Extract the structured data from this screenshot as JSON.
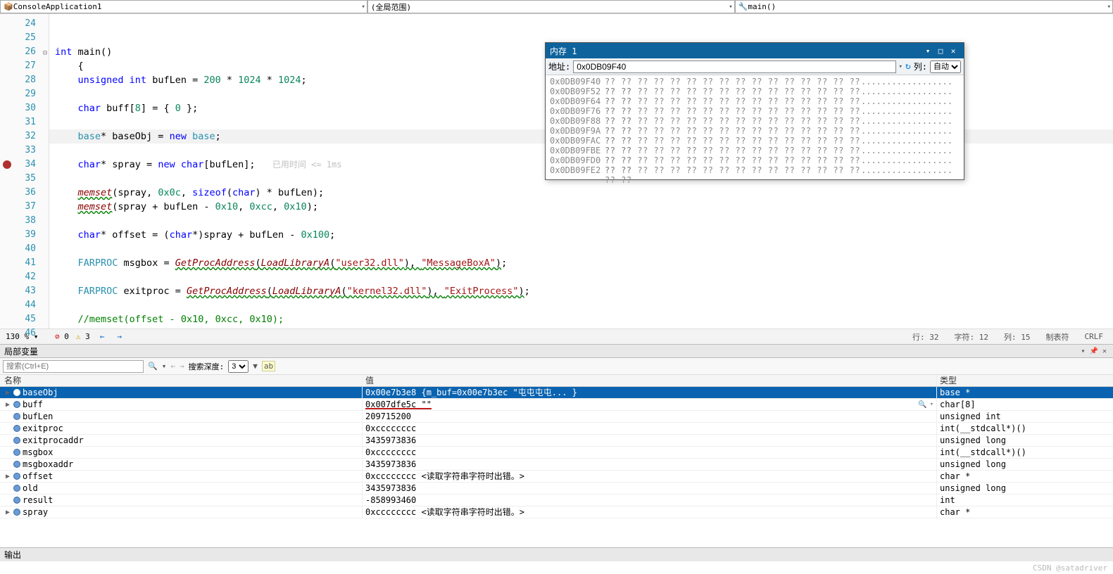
{
  "top": {
    "left": "ConsoleApplication1",
    "mid": "(全局范围)",
    "right": "main()"
  },
  "code": {
    "lines": [
      {
        "n": 24
      },
      {
        "n": 25
      },
      {
        "n": 26,
        "collapse": true,
        "seg": [
          {
            "t": "int ",
            "c": "kw"
          },
          {
            "t": "main"
          },
          {
            "t": "()"
          }
        ]
      },
      {
        "n": 27,
        "seg": [
          {
            "t": "{"
          }
        ]
      },
      {
        "n": 28,
        "ind": 1,
        "seg": [
          {
            "t": "unsigned int ",
            "c": "kw"
          },
          {
            "t": "bufLen = "
          },
          {
            "t": "200",
            "c": "num"
          },
          {
            "t": " * "
          },
          {
            "t": "1024",
            "c": "num"
          },
          {
            "t": " * "
          },
          {
            "t": "1024",
            "c": "num"
          },
          {
            "t": ";"
          }
        ]
      },
      {
        "n": 29
      },
      {
        "n": 30,
        "ind": 1,
        "seg": [
          {
            "t": "char ",
            "c": "kw"
          },
          {
            "t": "buff["
          },
          {
            "t": "8",
            "c": "num"
          },
          {
            "t": "] = { "
          },
          {
            "t": "0",
            "c": "num"
          },
          {
            "t": " };"
          }
        ]
      },
      {
        "n": 31
      },
      {
        "n": 32,
        "ind": 1,
        "cur": true,
        "seg": [
          {
            "t": "base",
            "c": "typ"
          },
          {
            "t": "* baseObj = "
          },
          {
            "t": "new ",
            "c": "kw"
          },
          {
            "t": "base",
            "c": "typ"
          },
          {
            "t": ";"
          }
        ]
      },
      {
        "n": 33
      },
      {
        "n": 34,
        "ind": 1,
        "bp": true,
        "seg": [
          {
            "t": "char",
            "c": "kw"
          },
          {
            "t": "* spray = "
          },
          {
            "t": "new ",
            "c": "kw"
          },
          {
            "t": "char",
            "c": "kw"
          },
          {
            "t": "[bufLen];   "
          },
          {
            "t": "已用时间 <= 1ms",
            "c": "dim"
          }
        ]
      },
      {
        "n": 35
      },
      {
        "n": 36,
        "ind": 1,
        "seg": [
          {
            "t": "memset",
            "c": "fn",
            "w": true
          },
          {
            "t": "(spray, "
          },
          {
            "t": "0x0c",
            "c": "num"
          },
          {
            "t": ", "
          },
          {
            "t": "sizeof",
            "c": "kw"
          },
          {
            "t": "("
          },
          {
            "t": "char",
            "c": "kw"
          },
          {
            "t": ") * bufLen);"
          }
        ]
      },
      {
        "n": 37,
        "ind": 1,
        "seg": [
          {
            "t": "memset",
            "c": "fn",
            "w": true
          },
          {
            "t": "(spray + bufLen - "
          },
          {
            "t": "0x10",
            "c": "num"
          },
          {
            "t": ", "
          },
          {
            "t": "0xcc",
            "c": "num"
          },
          {
            "t": ", "
          },
          {
            "t": "0x10",
            "c": "num"
          },
          {
            "t": ");"
          }
        ]
      },
      {
        "n": 38
      },
      {
        "n": 39,
        "ind": 1,
        "seg": [
          {
            "t": "char",
            "c": "kw"
          },
          {
            "t": "* offset = ("
          },
          {
            "t": "char",
            "c": "kw"
          },
          {
            "t": "*)spray + bufLen - "
          },
          {
            "t": "0x100",
            "c": "num"
          },
          {
            "t": ";"
          }
        ]
      },
      {
        "n": 40
      },
      {
        "n": 41,
        "ind": 1,
        "seg": [
          {
            "t": "FARPROC",
            "c": "typ"
          },
          {
            "t": " msgbox = "
          },
          {
            "t": "GetProcAddress",
            "c": "fn",
            "w": true
          },
          {
            "t": "(",
            "w": true
          },
          {
            "t": "LoadLibraryA",
            "c": "fn",
            "w": true
          },
          {
            "t": "(",
            "w": true
          },
          {
            "t": "\"user32.dll\"",
            "c": "str",
            "w": true
          },
          {
            "t": "), ",
            "w": true
          },
          {
            "t": "\"MessageBoxA\"",
            "c": "str",
            "w": true
          },
          {
            "t": ")",
            "w": true
          },
          {
            "t": ";"
          }
        ]
      },
      {
        "n": 42
      },
      {
        "n": 43,
        "ind": 1,
        "seg": [
          {
            "t": "FARPROC",
            "c": "typ"
          },
          {
            "t": " exitproc = "
          },
          {
            "t": "GetProcAddress",
            "c": "fn",
            "w": true
          },
          {
            "t": "(",
            "w": true
          },
          {
            "t": "LoadLibraryA",
            "c": "fn",
            "w": true
          },
          {
            "t": "(",
            "w": true
          },
          {
            "t": "\"kernel32.dll\"",
            "c": "str",
            "w": true
          },
          {
            "t": "), ",
            "w": true
          },
          {
            "t": "\"ExitProcess\"",
            "c": "str",
            "w": true
          },
          {
            "t": ")",
            "w": true
          },
          {
            "t": ";"
          }
        ]
      },
      {
        "n": 44
      },
      {
        "n": 45,
        "ind": 1,
        "seg": [
          {
            "t": "//memset(offset - 0x10, 0xcc, 0x10);",
            "c": "com"
          }
        ]
      },
      {
        "n": 46
      }
    ]
  },
  "memory": {
    "title": "内存 1",
    "addr_label": "地址:",
    "addr_value": "0x0DB09F40",
    "col_label": "列:",
    "col_value": "自动",
    "rows": [
      "0x0DB09F40",
      "0x0DB09F52",
      "0x0DB09F64",
      "0x0DB09F76",
      "0x0DB09F88",
      "0x0DB09F9A",
      "0x0DB09FAC",
      "0x0DB09FBE",
      "0x0DB09FD0",
      "0x0DB09FE2"
    ],
    "hex": "?? ?? ?? ?? ?? ?? ?? ?? ?? ?? ?? ?? ?? ?? ?? ?? ?? ??",
    "asc": ".................."
  },
  "status": {
    "zoom": "130 %",
    "err": "0",
    "warn": "3",
    "line_lbl": "行:",
    "line": "32",
    "char_lbl": "字符:",
    "char": "12",
    "col_lbl": "列:",
    "col": "15",
    "tab": "制表符",
    "crlf": "CRLF"
  },
  "locals": {
    "title": "局部变量",
    "search_ph": "搜索(Ctrl+E)",
    "depth_lbl": "搜索深度:",
    "depth": "3",
    "hdr": {
      "name": "名称",
      "val": "值",
      "type": "类型"
    },
    "rows": [
      {
        "exp": "▶",
        "name": "baseObj",
        "val": "0x00e7b3e8 {m_buf=0x00e7b3ec \"屯屯屯屯... }",
        "type": "base *",
        "sel": true
      },
      {
        "exp": "▶",
        "name": "buff",
        "val": "0x007dfe5c \"\"",
        "type": "char[8]",
        "mag": true,
        "under": true
      },
      {
        "exp": "",
        "name": "bufLen",
        "val": "209715200",
        "type": "unsigned int"
      },
      {
        "exp": "",
        "name": "exitproc",
        "val": "0xcccccccc",
        "type": "int(__stdcall*)()"
      },
      {
        "exp": "",
        "name": "exitprocaddr",
        "val": "3435973836",
        "type": "unsigned long"
      },
      {
        "exp": "",
        "name": "msgbox",
        "val": "0xcccccccc",
        "type": "int(__stdcall*)()"
      },
      {
        "exp": "",
        "name": "msgboxaddr",
        "val": "3435973836",
        "type": "unsigned long"
      },
      {
        "exp": "▶",
        "name": "offset",
        "val": "0xcccccccc <读取字符串字符时出错。>",
        "type": "char *"
      },
      {
        "exp": "",
        "name": "old",
        "val": "3435973836",
        "type": "unsigned long"
      },
      {
        "exp": "",
        "name": "result",
        "val": "-858993460",
        "type": "int"
      },
      {
        "exp": "▶",
        "name": "spray",
        "val": "0xcccccccc <读取字符串字符时出错。>",
        "type": "char *"
      }
    ]
  },
  "output": "输出",
  "watermark": "CSDN @satadriver"
}
